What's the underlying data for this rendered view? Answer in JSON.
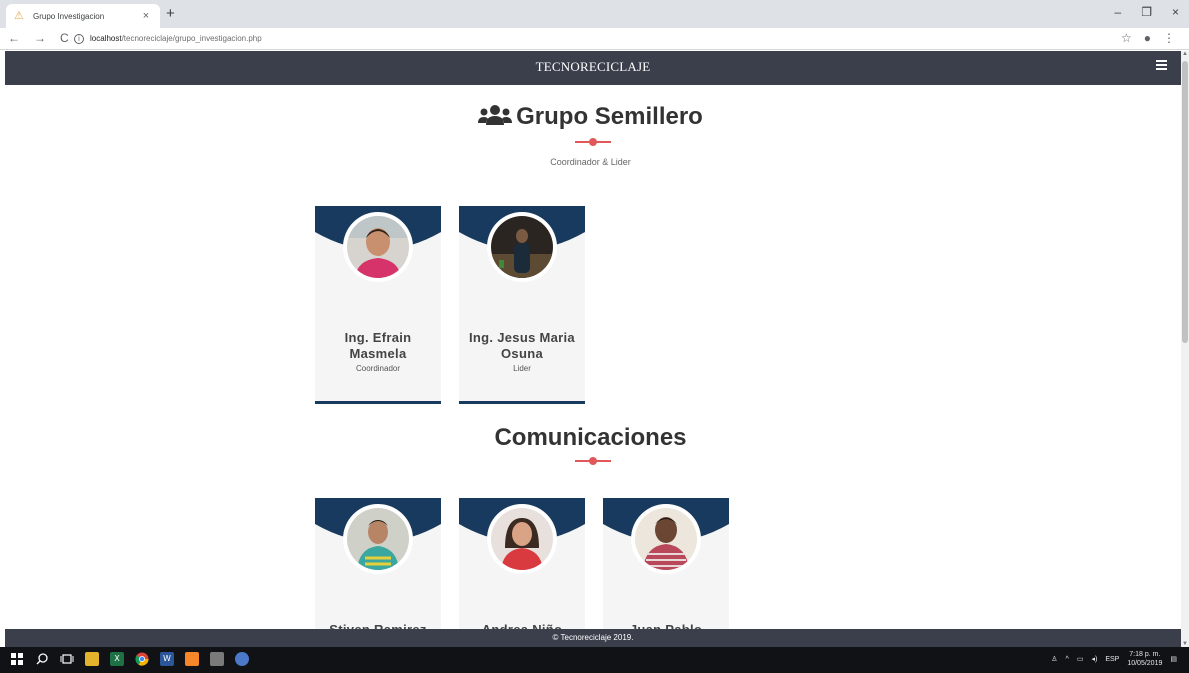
{
  "browser": {
    "tab_title": "Grupo Investigacion",
    "tab_close": "×",
    "new_tab": "+",
    "url_host": "localhost",
    "url_path": "/tecnoreciclaje/grupo_investigacion.php",
    "nav_back": "←",
    "nav_forward": "→",
    "nav_reload": "C",
    "info": "i",
    "star": "☆",
    "account": "●",
    "more": "⋮",
    "win_minimize": "–",
    "win_restore": "❐",
    "win_close": "×"
  },
  "navbar": {
    "brand": "TECNORECICLAJE"
  },
  "colors": {
    "navbar": "#3b3f4c",
    "card_header": "#173a5e",
    "accent": "#e0585a",
    "card_bg": "#f5f5f5"
  },
  "sections": [
    {
      "title": "Grupo Semillero",
      "subtitle": "Coordinador & Lider",
      "icon": "users-icon",
      "members": [
        {
          "name": "Ing. Efrain Masmela",
          "role": "Coordinador"
        },
        {
          "name": "Ing. Jesus Maria Osuna",
          "role": "Lider"
        }
      ]
    },
    {
      "title": "Comunicaciones",
      "members": [
        {
          "name": "Stiven Ramirez",
          "role": ""
        },
        {
          "name": "Andrea Niño",
          "role": ""
        },
        {
          "name": "Juan Pablo",
          "role": ""
        }
      ]
    }
  ],
  "footer": {
    "text": "© Tecnoreciclaje 2019."
  },
  "taskbar": {
    "lang": "ESP",
    "time": "7:18 p. m.",
    "date": "10/05/2019"
  }
}
